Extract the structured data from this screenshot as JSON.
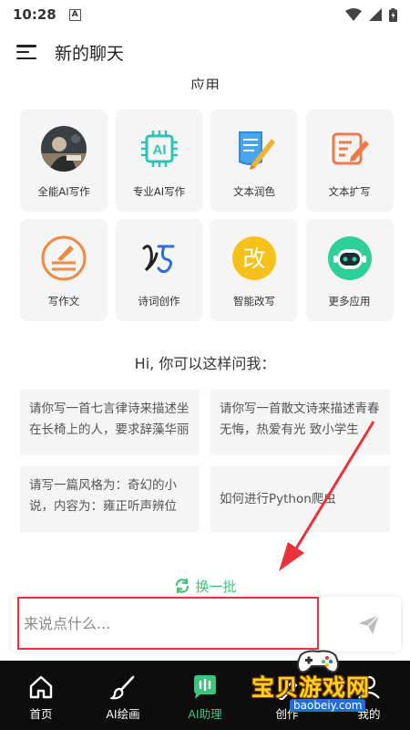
{
  "status": {
    "time": "10:28",
    "app_glyph": "A"
  },
  "header": {
    "title": "新的聊天"
  },
  "apps_section": {
    "title": "应用"
  },
  "apps": [
    {
      "label": "全能AI写作",
      "icon": "photo-avatar-icon"
    },
    {
      "label": "专业AI写作",
      "icon": "ai-badge-icon"
    },
    {
      "label": "文本润色",
      "icon": "paper-pen-icon"
    },
    {
      "label": "文本扩写",
      "icon": "edit-note-icon"
    },
    {
      "label": "写作文",
      "icon": "writing-icon"
    },
    {
      "label": "诗词创作",
      "icon": "poem-icon"
    },
    {
      "label": "智能改写",
      "icon": "rewrite-icon",
      "glyph": "改"
    },
    {
      "label": "更多应用",
      "icon": "robot-icon"
    }
  ],
  "suggestions": {
    "title": "Hi, 你可以这样问我：",
    "items": [
      "请你写一首七言律诗来描述坐在长椅上的人，要求辞藻华丽",
      "请你写一首散文诗来描述青春无悔，热爱有光 致小学生",
      "请写一篇风格为：奇幻的小说，内容为：雍正听声辨位",
      "如何进行Python爬虫"
    ],
    "refresh_label": "换一批"
  },
  "input": {
    "placeholder": "来说点什么..."
  },
  "nav": [
    {
      "label": "首页",
      "icon": "home-icon"
    },
    {
      "label": "AI绘画",
      "icon": "brush-icon"
    },
    {
      "label": "AI助理",
      "icon": "chat-assistant-icon",
      "active": true
    },
    {
      "label": "创作",
      "icon": "create-icon"
    },
    {
      "label": "我的",
      "icon": "profile-icon"
    }
  ],
  "watermark": {
    "text": "宝贝游戏网",
    "url": "baobeiy.com"
  },
  "colors": {
    "accent": "#3cc47c",
    "highlight": "#e8333a",
    "nav_bg": "#0d0d0d"
  }
}
